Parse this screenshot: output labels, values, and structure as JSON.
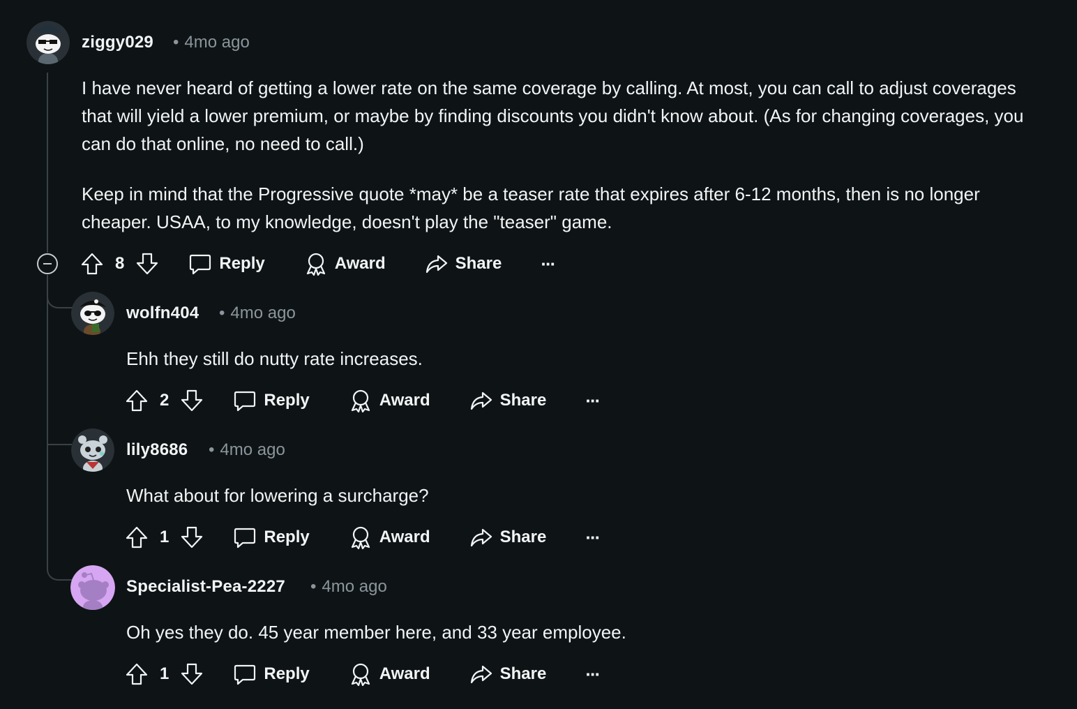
{
  "comments": [
    {
      "username": "ziggy029",
      "time": "4mo ago",
      "paragraphs": [
        "I have never heard of getting a lower rate on the same coverage by calling. At most, you can call to adjust coverages that will yield a lower premium, or maybe by finding discounts you didn't know about. (As for changing coverages, you can do that online, no need to call.)",
        "Keep in mind that the Progressive quote *may* be a teaser rate that expires after 6-12 months, then is no longer cheaper. USAA, to my knowledge, doesn't play the \"teaser\" game."
      ],
      "score": "8"
    },
    {
      "username": "wolfn404",
      "time": "4mo ago",
      "paragraphs": [
        "Ehh they still do nutty rate increases."
      ],
      "score": "2"
    },
    {
      "username": "lily8686",
      "time": "4mo ago",
      "paragraphs": [
        "What about for lowering a surcharge?"
      ],
      "score": "1"
    },
    {
      "username": "Specialist-Pea-2227",
      "time": "4mo ago",
      "paragraphs": [
        "Oh yes they do. 45 year member here, and 33 year employee."
      ],
      "score": "1"
    }
  ],
  "actions": {
    "reply": "Reply",
    "award": "Award",
    "share": "Share",
    "more": "···"
  },
  "colors": {
    "background": "#0e1416",
    "text": "#f2f4f5",
    "meta": "#8b959b",
    "thread_line": "#3a4145",
    "default_avatar": "#d6a6f2"
  }
}
